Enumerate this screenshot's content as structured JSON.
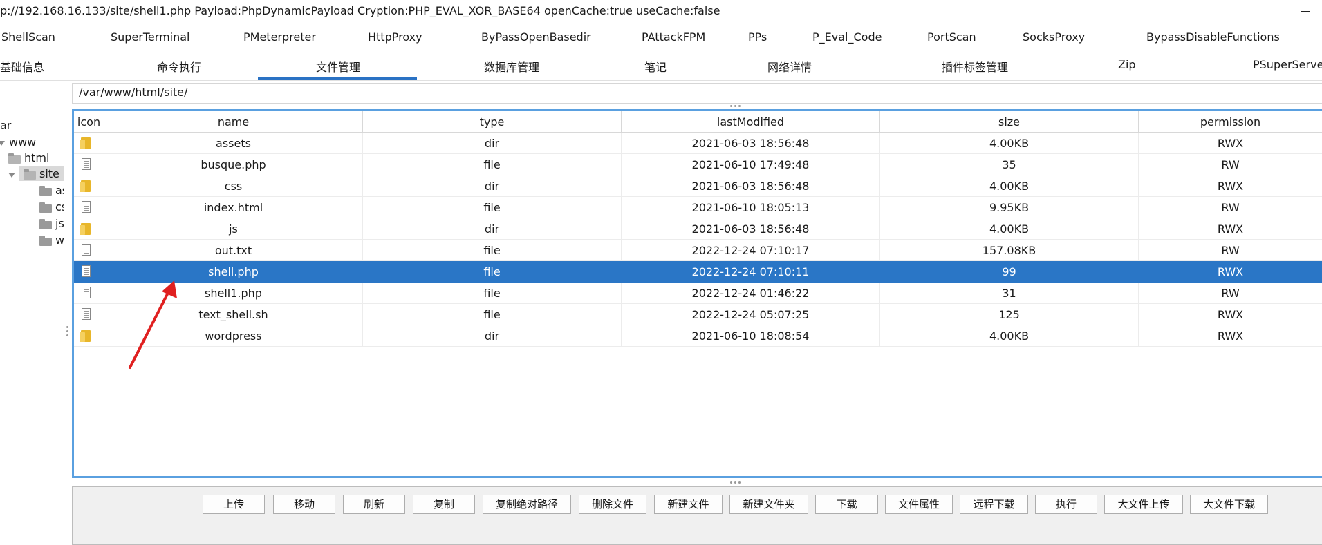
{
  "window": {
    "title": "p://192.168.16.133/site/shell1.php Payload:PhpDynamicPayload Cryption:PHP_EVAL_XOR_BASE64 openCache:true useCache:false"
  },
  "plugin_tabs": [
    {
      "label": "ShellScan"
    },
    {
      "label": "SuperTerminal"
    },
    {
      "label": "PMeterpreter"
    },
    {
      "label": "HttpProxy"
    },
    {
      "label": "ByPassOpenBasedir"
    },
    {
      "label": "PAttackFPM"
    },
    {
      "label": "PPs"
    },
    {
      "label": "P_Eval_Code"
    },
    {
      "label": "PortScan"
    },
    {
      "label": "SocksProxy"
    },
    {
      "label": "BypassDisableFunctions"
    }
  ],
  "main_tabs": [
    {
      "label": "基础信息"
    },
    {
      "label": "命令执行"
    },
    {
      "label": "文件管理",
      "active": true
    },
    {
      "label": "数据库管理"
    },
    {
      "label": "笔记"
    },
    {
      "label": "网络详情"
    },
    {
      "label": "插件标签管理"
    },
    {
      "label": "Zip"
    },
    {
      "label": "PSuperServer"
    }
  ],
  "tree": {
    "nodes": [
      {
        "label": "ar"
      },
      {
        "label": "www"
      },
      {
        "label": "html"
      },
      {
        "label": "site",
        "selected": true
      },
      {
        "label": "as"
      },
      {
        "label": "cs"
      },
      {
        "label": "js"
      },
      {
        "label": "w"
      }
    ]
  },
  "path_bar": {
    "value": "/var/www/html/site/"
  },
  "table": {
    "columns": [
      "icon",
      "name",
      "type",
      "lastModified",
      "size",
      "permission"
    ],
    "rows": [
      {
        "name": "assets",
        "type": "dir",
        "lastModified": "2021-06-03 18:56:48",
        "size": "4.00KB",
        "permission": "RWX",
        "icon": "folder-icon"
      },
      {
        "name": "busque.php",
        "type": "file",
        "lastModified": "2021-06-10 17:49:48",
        "size": "35",
        "permission": "RW",
        "icon": "file-icon"
      },
      {
        "name": "css",
        "type": "dir",
        "lastModified": "2021-06-03 18:56:48",
        "size": "4.00KB",
        "permission": "RWX",
        "icon": "folder-icon"
      },
      {
        "name": "index.html",
        "type": "file",
        "lastModified": "2021-06-10 18:05:13",
        "size": "9.95KB",
        "permission": "RW",
        "icon": "file-icon"
      },
      {
        "name": "js",
        "type": "dir",
        "lastModified": "2021-06-03 18:56:48",
        "size": "4.00KB",
        "permission": "RWX",
        "icon": "folder-icon"
      },
      {
        "name": "out.txt",
        "type": "file",
        "lastModified": "2022-12-24 07:10:17",
        "size": "157.08KB",
        "permission": "RW",
        "icon": "file-icon"
      },
      {
        "name": "shell.php",
        "type": "file",
        "lastModified": "2022-12-24 07:10:11",
        "size": "99",
        "permission": "RWX",
        "icon": "file-icon",
        "selected": true
      },
      {
        "name": "shell1.php",
        "type": "file",
        "lastModified": "2022-12-24 01:46:22",
        "size": "31",
        "permission": "RW",
        "icon": "file-icon"
      },
      {
        "name": "text_shell.sh",
        "type": "file",
        "lastModified": "2022-12-24 05:07:25",
        "size": "125",
        "permission": "RWX",
        "icon": "file-icon"
      },
      {
        "name": "wordpress",
        "type": "dir",
        "lastModified": "2021-06-10 18:08:54",
        "size": "4.00KB",
        "permission": "RWX",
        "icon": "folder-icon"
      }
    ]
  },
  "buttons": [
    {
      "label": "上传"
    },
    {
      "label": "移动"
    },
    {
      "label": "刷新"
    },
    {
      "label": "复制"
    },
    {
      "label": "复制绝对路径"
    },
    {
      "label": "删除文件"
    },
    {
      "label": "新建文件"
    },
    {
      "label": "新建文件夹"
    },
    {
      "label": "下载"
    },
    {
      "label": "文件属性"
    },
    {
      "label": "远程下载"
    },
    {
      "label": "执行"
    },
    {
      "label": "大文件上传"
    },
    {
      "label": "大文件下载"
    }
  ],
  "colors": {
    "selection": "#2a76c6",
    "table_border": "#5aa0e0",
    "tab_underline": "#2a72c4",
    "annotation_arrow": "#e02020"
  }
}
